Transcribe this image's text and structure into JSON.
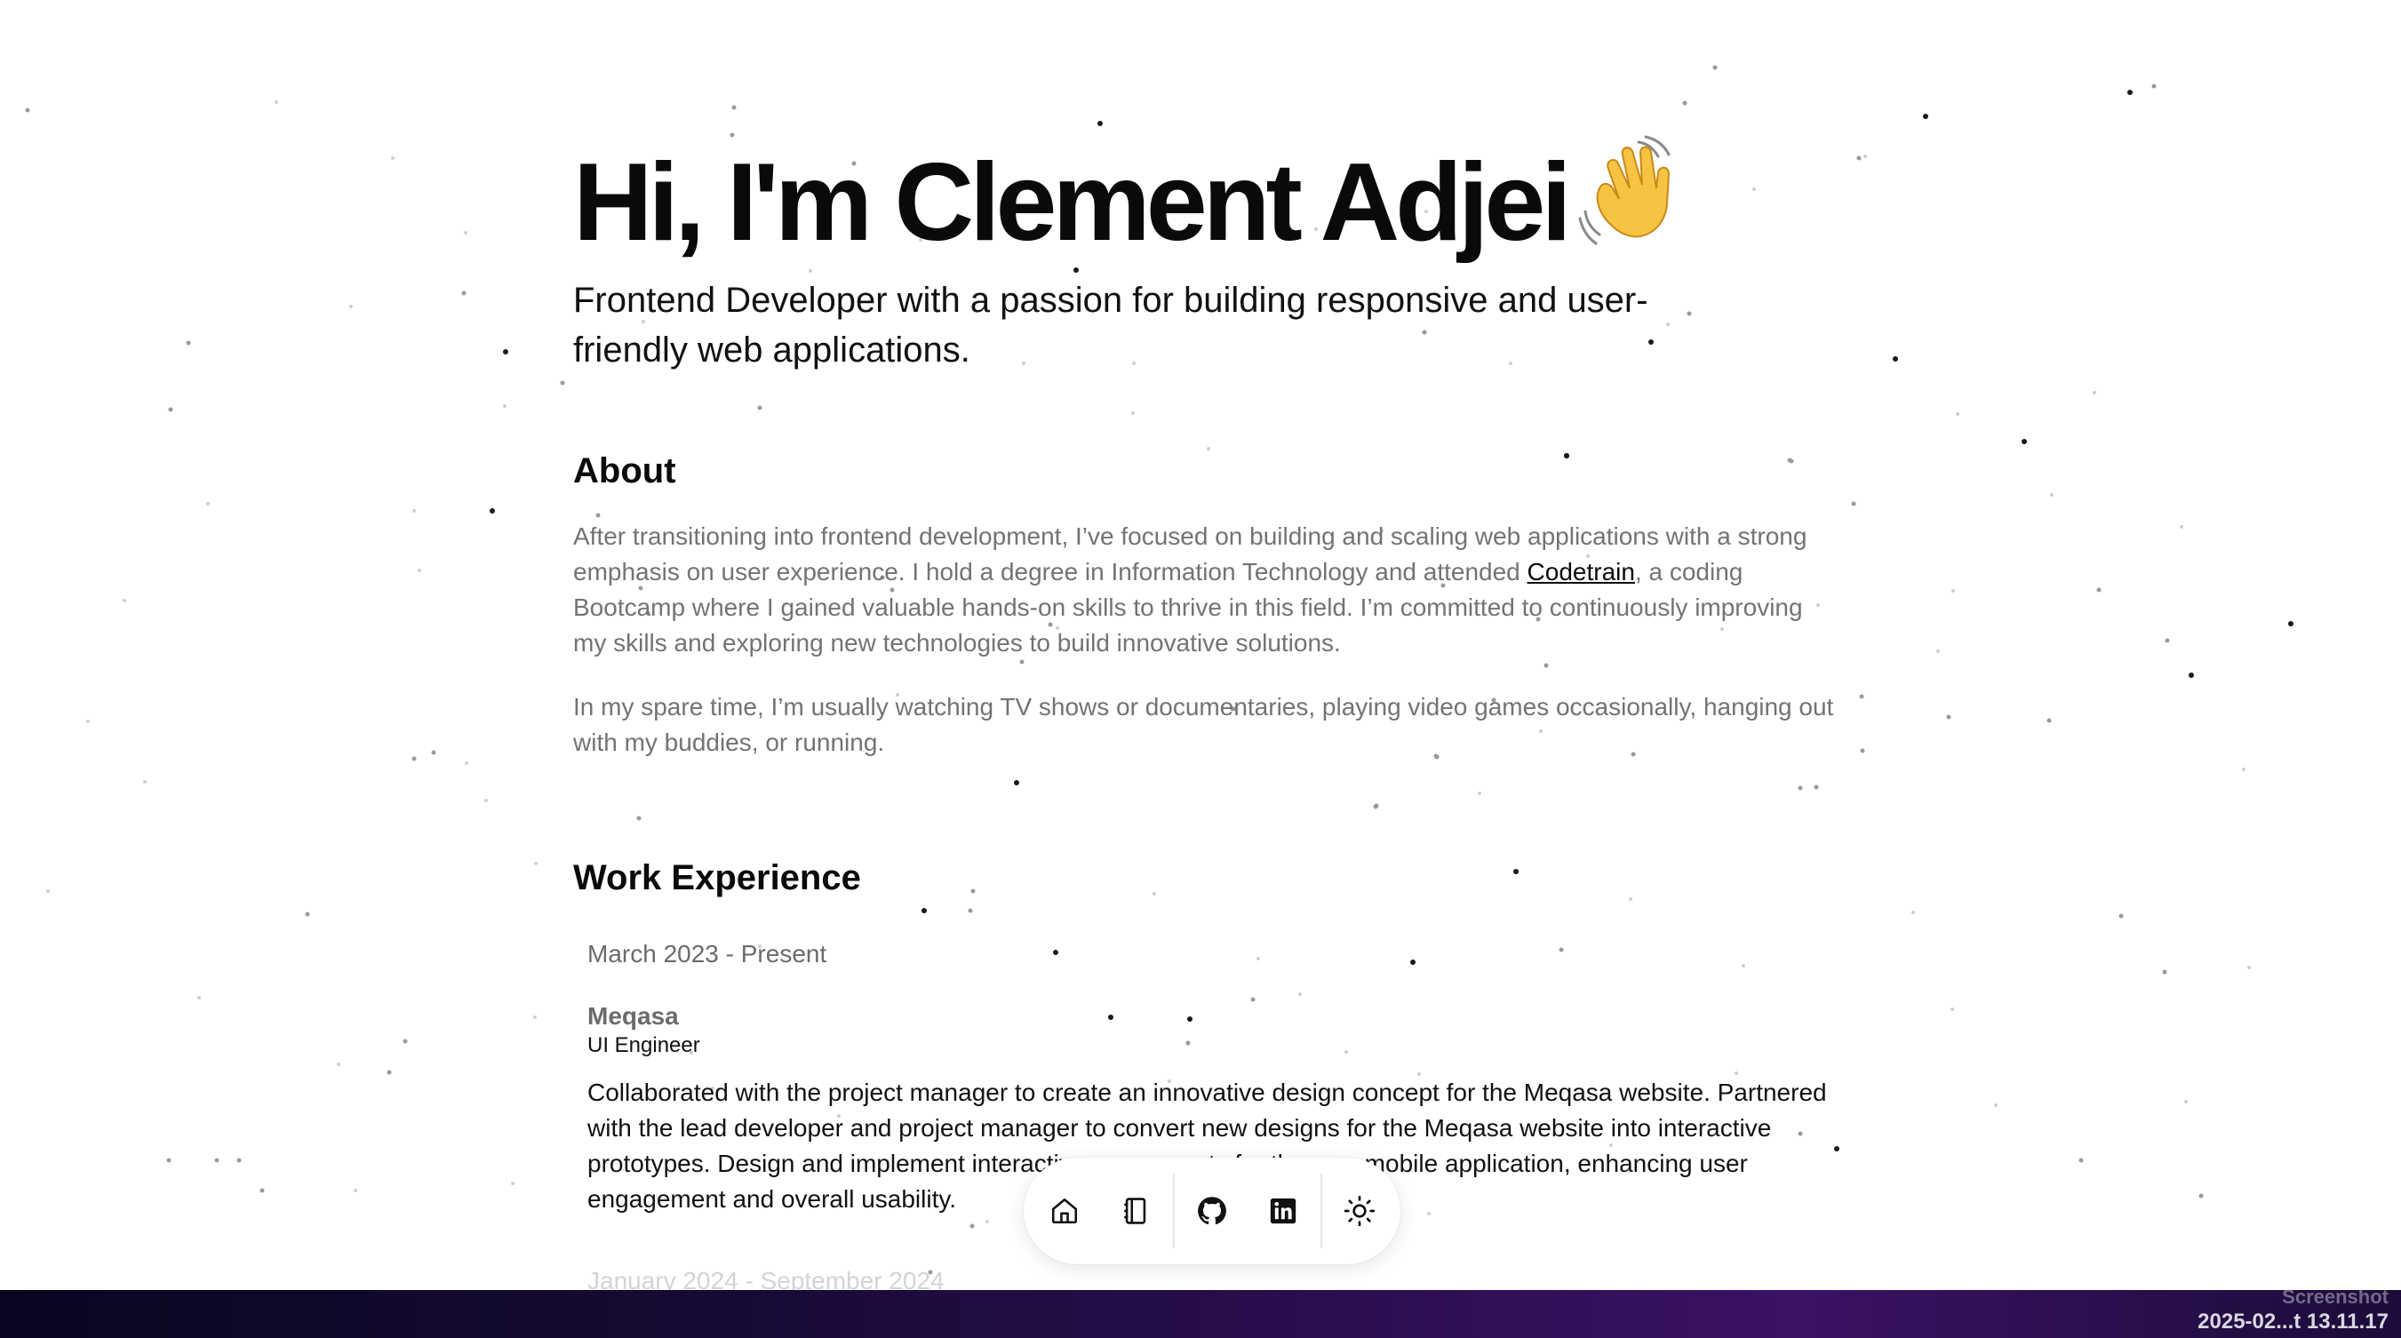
{
  "hero": {
    "greeting": "Hi, I'm Clement Adjei",
    "subtitle": "Frontend Developer with a passion for building responsive and user-friendly web applications."
  },
  "about": {
    "heading": "About",
    "p1_before": "After transitioning into frontend development, I’ve focused on building and scaling web applications with a strong emphasis on user experience. I hold a degree in Information Technology and attended ",
    "p1_link": "Codetrain",
    "p1_after": ", a coding Bootcamp where I gained valuable hands-on skills to thrive in this field. I’m committed to continuously improving my skills and exploring new technologies to build innovative solutions.",
    "p2": "In my spare time, I’m usually watching TV shows or documentaries, playing video games occasionally, hanging out with my buddies, or running."
  },
  "work": {
    "heading": "Work Experience",
    "jobs": [
      {
        "date": "March 2023 - Present",
        "company": "Meqasa",
        "role": "UI Engineer",
        "description": "Collaborated with the project manager to create an innovative design concept for the Meqasa website. Partnered with the lead developer and project manager to convert new designs for the Meqasa website into interactive prototypes. Design and implement interactive components for the new mobile application, enhancing user engagement and overall usability."
      },
      {
        "date": "January 2024 - September 2024"
      }
    ]
  },
  "dock": {
    "items": [
      {
        "icon": "home-icon"
      },
      {
        "icon": "notebook-icon"
      },
      {
        "icon": "github-icon"
      },
      {
        "icon": "linkedin-icon"
      },
      {
        "icon": "sun-icon"
      }
    ]
  },
  "taskbar": {
    "label_top": "Screenshot",
    "label": "2025-02...t 13.11.17"
  },
  "colors": {
    "text": "#0a0a0a",
    "muted": "#737373",
    "taskbar_accent": "#3a1363"
  }
}
